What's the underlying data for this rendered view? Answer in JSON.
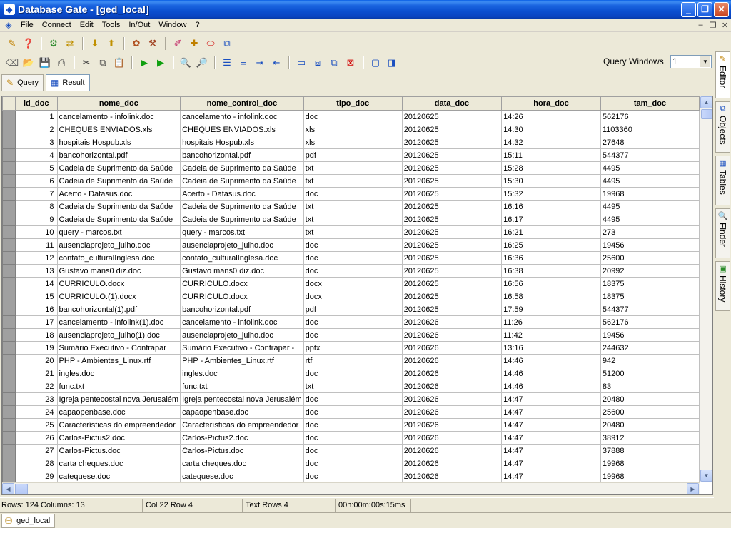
{
  "window": {
    "title": "Database Gate - [ged_local]"
  },
  "menu": [
    "File",
    "Connect",
    "Edit",
    "Tools",
    "In/Out",
    "Window",
    "?"
  ],
  "toolbar": {
    "query_windows_label": "Query Windows",
    "query_windows_value": "1"
  },
  "tabs": {
    "query": "Query",
    "result": "Result"
  },
  "side_tabs": [
    "Editor",
    "Objects",
    "Tables",
    "Finder",
    "History"
  ],
  "grid": {
    "columns": [
      "id_doc",
      "nome_doc",
      "nome_control_doc",
      "tipo_doc",
      "data_doc",
      "hora_doc",
      "tam_doc"
    ],
    "rows": [
      [
        "1",
        "cancelamento - infolink.doc",
        "cancelamento - infolink.doc",
        "doc",
        "20120625",
        "14:26",
        "562176"
      ],
      [
        "2",
        "CHEQUES ENVIADOS.xls",
        "CHEQUES ENVIADOS.xls",
        "xls",
        "20120625",
        "14:30",
        "1103360"
      ],
      [
        "3",
        "hospitais Hospub.xls",
        "hospitais Hospub.xls",
        "xls",
        "20120625",
        "14:32",
        "27648"
      ],
      [
        "4",
        "bancohorizontal.pdf",
        "bancohorizontal.pdf",
        "pdf",
        "20120625",
        "15:11",
        "544377"
      ],
      [
        "5",
        "Cadeia de Suprimento da Saúde",
        "Cadeia de Suprimento da Saúde",
        "txt",
        "20120625",
        "15:28",
        "4495"
      ],
      [
        "6",
        "Cadeia de Suprimento da Saúde",
        "Cadeia de Suprimento da Saúde",
        "txt",
        "20120625",
        "15:30",
        "4495"
      ],
      [
        "7",
        "Acerto - Datasus.doc",
        "Acerto - Datasus.doc",
        "doc",
        "20120625",
        "15:32",
        "19968"
      ],
      [
        "8",
        "Cadeia de Suprimento da Saúde",
        "Cadeia de Suprimento da Saúde",
        "txt",
        "20120625",
        "16:16",
        "4495"
      ],
      [
        "9",
        "Cadeia de Suprimento da Saúde",
        "Cadeia de Suprimento da Saúde",
        "txt",
        "20120625",
        "16:17",
        "4495"
      ],
      [
        "10",
        "query - marcos.txt",
        "query - marcos.txt",
        "txt",
        "20120625",
        "16:21",
        "273"
      ],
      [
        "11",
        "ausenciaprojeto_julho.doc",
        "ausenciaprojeto_julho.doc",
        "doc",
        "20120625",
        "16:25",
        "19456"
      ],
      [
        "12",
        "contato_culturalInglesa.doc",
        "contato_culturalInglesa.doc",
        "doc",
        "20120625",
        "16:36",
        "25600"
      ],
      [
        "13",
        "Gustavo mans0 diz.doc",
        "Gustavo mans0 diz.doc",
        "doc",
        "20120625",
        "16:38",
        "20992"
      ],
      [
        "14",
        "CURRICULO.docx",
        "CURRICULO.docx",
        "docx",
        "20120625",
        "16:56",
        "18375"
      ],
      [
        "15",
        "CURRICULO.(1).docx",
        "CURRICULO.docx",
        "docx",
        "20120625",
        "16:58",
        "18375"
      ],
      [
        "16",
        "bancohorizontal(1).pdf",
        "bancohorizontal.pdf",
        "pdf",
        "20120625",
        "17:59",
        "544377"
      ],
      [
        "17",
        "cancelamento - infolink(1).doc",
        "cancelamento - infolink.doc",
        "doc",
        "20120626",
        "11:26",
        "562176"
      ],
      [
        "18",
        "ausenciaprojeto_julho(1).doc",
        "ausenciaprojeto_julho.doc",
        "doc",
        "20120626",
        "11:42",
        "19456"
      ],
      [
        "19",
        "Sumário Executivo - Confrapar",
        "Sumário Executivo - Confrapar -",
        "pptx",
        "20120626",
        "13:16",
        "244632"
      ],
      [
        "20",
        "PHP - Ambientes_Linux.rtf",
        "PHP - Ambientes_Linux.rtf",
        "rtf",
        "20120626",
        "14:46",
        "942"
      ],
      [
        "21",
        "ingles.doc",
        "ingles.doc",
        "doc",
        "20120626",
        "14:46",
        "51200"
      ],
      [
        "22",
        "func.txt",
        "func.txt",
        "txt",
        "20120626",
        "14:46",
        "83"
      ],
      [
        "23",
        "Igreja pentecostal nova Jerusalém",
        "Igreja pentecostal nova Jerusalém",
        "doc",
        "20120626",
        "14:47",
        "20480"
      ],
      [
        "24",
        "capaopenbase.doc",
        "capaopenbase.doc",
        "doc",
        "20120626",
        "14:47",
        "25600"
      ],
      [
        "25",
        "Características do empreendedor",
        "Características do empreendedor",
        "doc",
        "20120626",
        "14:47",
        "20480"
      ],
      [
        "26",
        "Carlos-Pictus2.doc",
        "Carlos-Pictus2.doc",
        "doc",
        "20120626",
        "14:47",
        "38912"
      ],
      [
        "27",
        "Carlos-Pictus.doc",
        "Carlos-Pictus.doc",
        "doc",
        "20120626",
        "14:47",
        "37888"
      ],
      [
        "28",
        "carta cheques.doc",
        "carta cheques.doc",
        "doc",
        "20120626",
        "14:47",
        "19968"
      ],
      [
        "29",
        "catequese.doc",
        "catequese.doc",
        "doc",
        "20120626",
        "14:47",
        "19968"
      ]
    ]
  },
  "status": {
    "rows_cols": "Rows: 124  Columns: 13",
    "position": "Col 22 Row 4",
    "text_rows": "Text Rows 4",
    "elapsed": "00h:00m:00s:15ms"
  },
  "bottom_tab": "ged_local"
}
